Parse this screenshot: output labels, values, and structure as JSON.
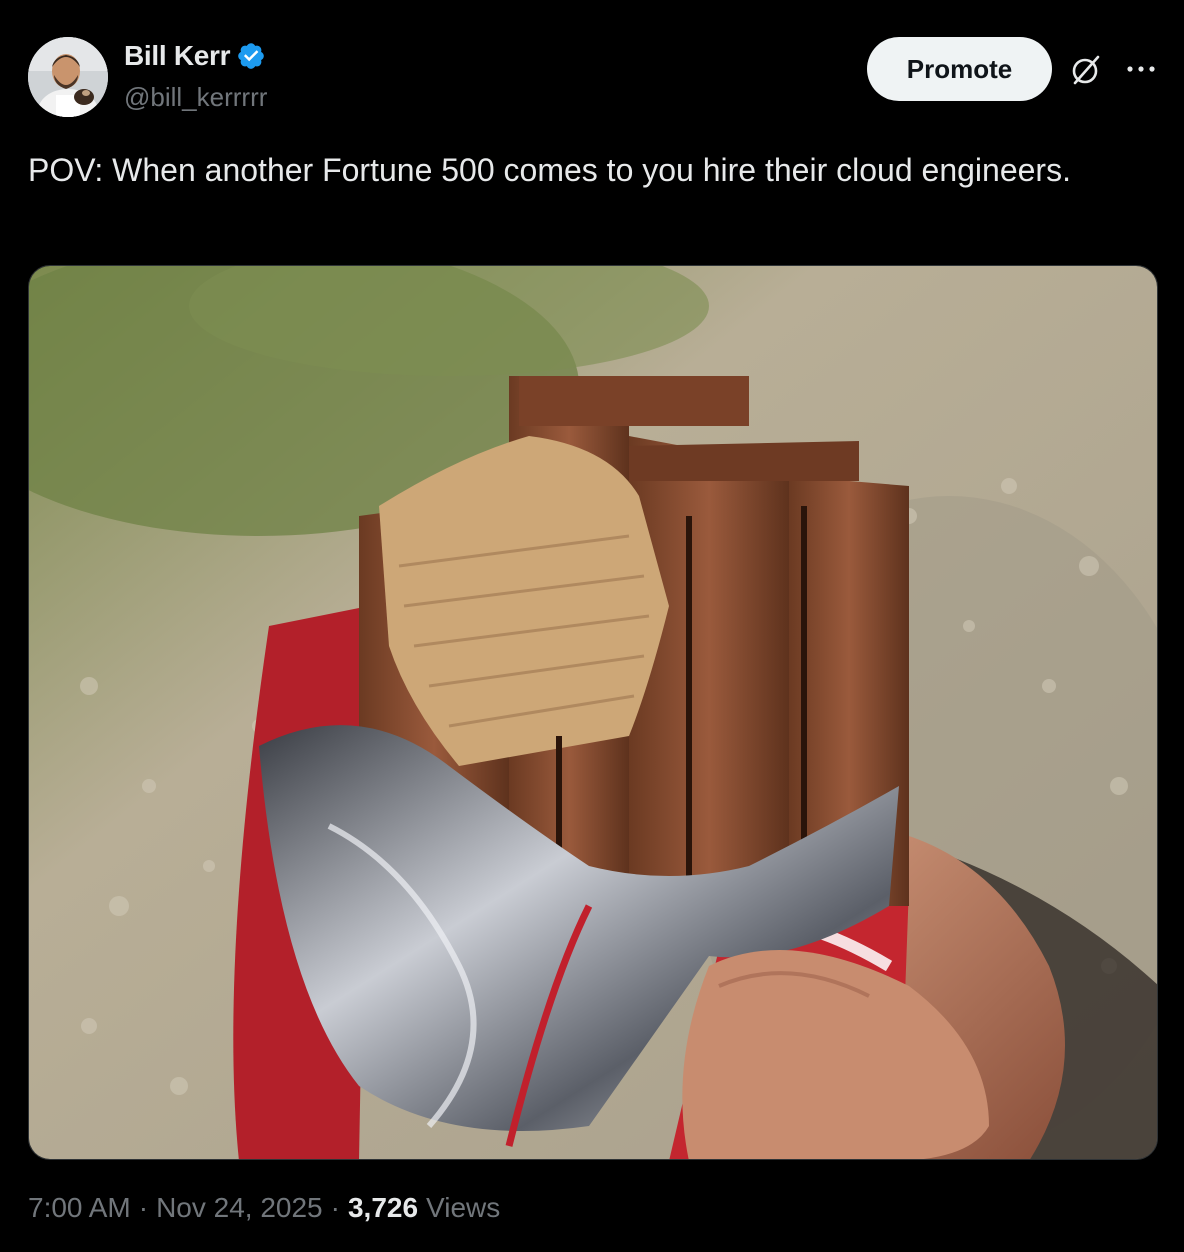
{
  "author": {
    "display_name": "Bill Kerr",
    "handle": "@bill_kerrrrr",
    "verified": true,
    "verified_color": "#1d9bf0"
  },
  "actions": {
    "promote_label": "Promote",
    "grok_icon": "grok-icon",
    "more_icon": "more-icon"
  },
  "tweet": {
    "text": "POV: When another Fortune 500 comes to you hire their cloud engineers.",
    "image_description_icon": "photo"
  },
  "meta": {
    "time": "7:00 AM",
    "separator": "·",
    "date": "Nov 24, 2025",
    "views_count": "3,726",
    "views_label": "Views"
  },
  "colors": {
    "background": "#000000",
    "primary_text": "#e7e9ea",
    "secondary_text": "#71767b",
    "button_bg": "#eff3f4",
    "button_text": "#0f1419"
  }
}
